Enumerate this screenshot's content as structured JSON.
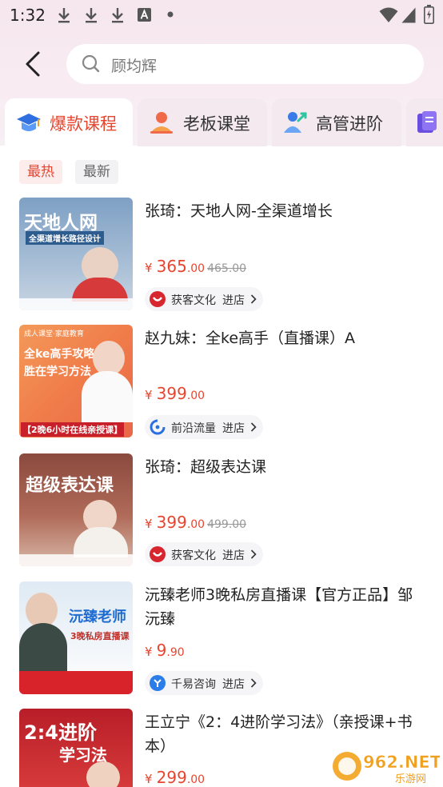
{
  "status_bar": {
    "time": "1:32",
    "icons": [
      "download-icon",
      "download-icon",
      "download-icon",
      "font-a-icon",
      "dot-icon",
      "wifi-icon",
      "cell-signal-icon",
      "battery-icon"
    ]
  },
  "search": {
    "query": "顾均辉"
  },
  "tabs": [
    {
      "label": "爆款课程",
      "icon": "graduation-cap-icon",
      "active": true
    },
    {
      "label": "老板课堂",
      "icon": "boss-icon",
      "active": false
    },
    {
      "label": "高管进阶",
      "icon": "executive-icon",
      "active": false
    },
    {
      "label": "",
      "icon": "book-icon",
      "active": false
    }
  ],
  "filters": [
    {
      "label": "最热",
      "active": true
    },
    {
      "label": "最新",
      "active": false
    }
  ],
  "colors": {
    "accent": "#e8452f",
    "header_bg": "#f6e6ee"
  },
  "products": [
    {
      "title": "张琦：天地人网-全渠道增长",
      "price_int": "365",
      "price_dec": ".00",
      "original_price": "465.00",
      "shop_name": "获客文化",
      "enter_label": "进店",
      "thumb": {
        "line1": "天地人网",
        "line2": "全渠道增长路径设计"
      }
    },
    {
      "title": "赵九妹：全ke高手（直播课）A",
      "price_int": "399",
      "price_dec": ".00",
      "original_price": "",
      "shop_name": "前沿流量",
      "enter_label": "进店",
      "thumb": {
        "line1": "全ke高手攻略",
        "line2": "胜在学习方法",
        "banner": "【2晚6小时在线亲授课】"
      }
    },
    {
      "title": "张琦：超级表达课",
      "price_int": "399",
      "price_dec": ".00",
      "original_price": "499.00",
      "shop_name": "获客文化",
      "enter_label": "进店",
      "thumb": {
        "line1": "超级表达课"
      }
    },
    {
      "title": "沅臻老师3晚私房直播课【官方正品】邹沅臻",
      "price_int": "9",
      "price_dec": ".90",
      "original_price": "",
      "shop_name": "千易咨询",
      "enter_label": "进店",
      "thumb": {
        "line1": "沅臻老师",
        "line2": "3晚私房直播课"
      }
    },
    {
      "title": "王立宁《2：4进阶学习法》（亲授课+书本）",
      "price_int": "299",
      "price_dec": ".00",
      "original_price": "",
      "shop_name": "",
      "enter_label": "",
      "thumb": {
        "line1": "2:4进阶",
        "line2": "学习法"
      }
    }
  ],
  "currency": "¥",
  "watermark": {
    "brand": "962.NET",
    "sub": "乐游网"
  }
}
